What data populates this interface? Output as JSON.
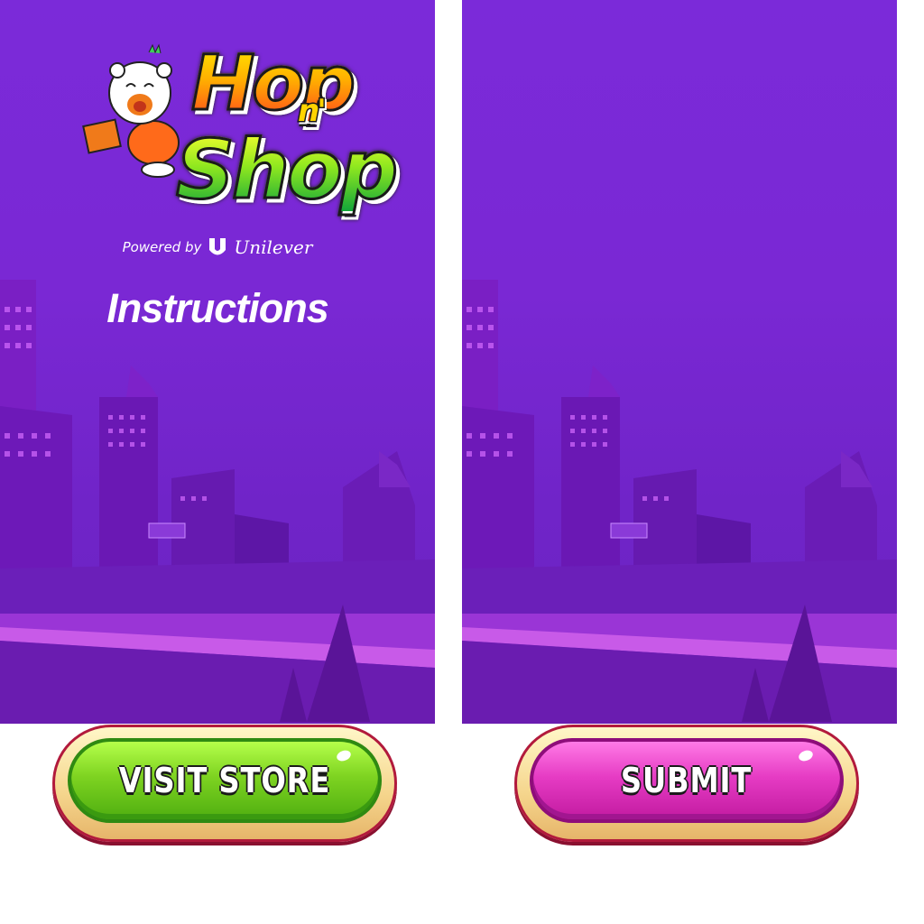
{
  "left_panel": {
    "logo": {
      "word1": "Hop",
      "word2": "n'",
      "word3": "Shop"
    },
    "powered_by": {
      "prefix": "Powered by",
      "brand": "Unilever"
    },
    "heading": "Instructions"
  },
  "buttons": {
    "visit_store": "VISIT STORE",
    "submit": "SUBMIT"
  },
  "colors": {
    "background_purple": "#7b2ad9",
    "visit_green": "#7ed321",
    "submit_magenta": "#e63cc4",
    "button_rim": "#f5d58c",
    "button_border": "#b21a3c"
  },
  "icons": {
    "mascot": "cat-mascot-icon",
    "brand_mark": "unilever-u-icon",
    "background": "city-skyline-illustration"
  }
}
